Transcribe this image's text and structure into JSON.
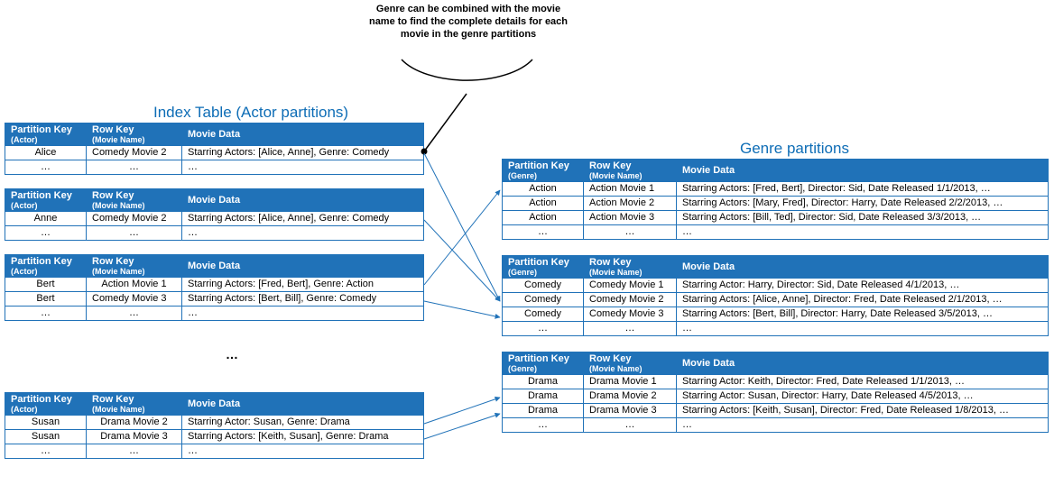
{
  "callout": "Genre can be combined with the movie name to find the complete details for each movie in the genre partitions",
  "leftTitle": "Index Table (Actor partitions)",
  "rightTitle": "Genre partitions",
  "ellipsis": "…",
  "dotsRow": "…",
  "headers": {
    "pk": "Partition Key",
    "rk": "Row Key",
    "actor": "(Actor)",
    "genre": "(Genre)",
    "movieName": "(Movie Name)",
    "movieData": "Movie Data"
  },
  "actorTables": [
    {
      "rows": [
        {
          "pk": "Alice",
          "rk": "Comedy Movie 2",
          "data": "Starring Actors: [Alice, Anne], Genre: Comedy"
        }
      ]
    },
    {
      "rows": [
        {
          "pk": "Anne",
          "rk": "Comedy Movie 2",
          "data": "Starring Actors: [Alice, Anne], Genre: Comedy"
        }
      ]
    },
    {
      "rows": [
        {
          "pk": "Bert",
          "rk": "Action Movie 1",
          "data": "Starring Actors: [Fred, Bert], Genre: Action"
        },
        {
          "pk": "Bert",
          "rk": "Comedy Movie 3",
          "data": "Starring Actors: [Bert, Bill], Genre: Comedy"
        }
      ]
    },
    {
      "rows": [
        {
          "pk": "Susan",
          "rk": "Drama Movie 2",
          "data": "Starring Actor: Susan, Genre: Drama"
        },
        {
          "pk": "Susan",
          "rk": "Drama Movie 3",
          "data": "Starring Actors: [Keith, Susan], Genre: Drama"
        }
      ]
    }
  ],
  "genreTables": [
    {
      "rows": [
        {
          "pk": "Action",
          "rk": "Action Movie 1",
          "data": "Starring Actors: [Fred, Bert], Director: Sid, Date Released 1/1/2013, …"
        },
        {
          "pk": "Action",
          "rk": "Action Movie 2",
          "data": "Starring Actors: [Mary, Fred], Director: Harry, Date Released 2/2/2013, …"
        },
        {
          "pk": "Action",
          "rk": "Action Movie 3",
          "data": "Starring Actors: [Bill, Ted], Director: Sid, Date Released 3/3/2013, …"
        }
      ]
    },
    {
      "rows": [
        {
          "pk": "Comedy",
          "rk": "Comedy Movie 1",
          "data": "Starring Actor: Harry, Director: Sid, Date Released 4/1/2013, …"
        },
        {
          "pk": "Comedy",
          "rk": "Comedy Movie 2",
          "data": "Starring Actors: [Alice, Anne], Director: Fred, Date Released 2/1/2013, …"
        },
        {
          "pk": "Comedy",
          "rk": "Comedy Movie 3",
          "data": "Starring Actors: [Bert, Bill], Director: Harry, Date Released 3/5/2013, …"
        }
      ]
    },
    {
      "rows": [
        {
          "pk": "Drama",
          "rk": "Drama Movie 1",
          "data": "Starring Actor: Keith, Director: Fred, Date Released 1/1/2013, …"
        },
        {
          "pk": "Drama",
          "rk": "Drama Movie 2",
          "data": "Starring Actor: Susan, Director: Harry, Date Released 4/5/2013, …"
        },
        {
          "pk": "Drama",
          "rk": "Drama Movie 3",
          "data": "Starring Actors: [Keith, Susan], Director: Fred, Date Released 1/8/2013, …"
        }
      ]
    }
  ]
}
